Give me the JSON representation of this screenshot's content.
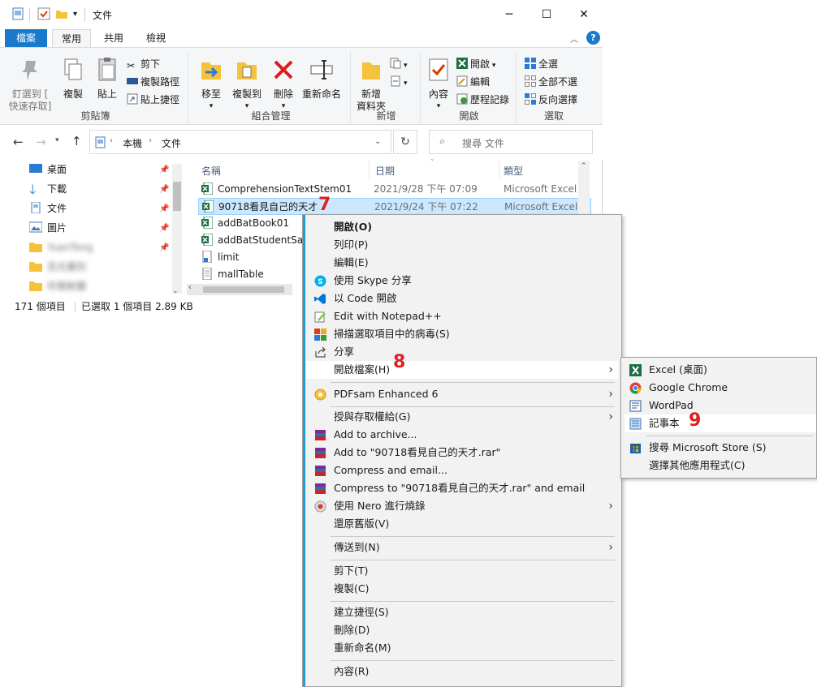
{
  "window": {
    "title": "文件",
    "controls": {
      "minimize": "─",
      "maximize": "☐",
      "close": "✕"
    }
  },
  "ribbon_tabs": [
    "檔案",
    "常用",
    "共用",
    "檢視"
  ],
  "ribbon": {
    "clipboard": {
      "pin_label_1": "釘選到 [",
      "pin_label_2": "快速存取]",
      "copy": "複製",
      "paste": "貼上",
      "cut": "剪下",
      "copy_path": "複製路徑",
      "paste_shortcut": "貼上捷徑",
      "group": "剪貼簿"
    },
    "organize": {
      "move_1": "移至",
      "copy_to_1": "複製到",
      "delete": "刪除",
      "rename": "重新命名",
      "group": "組合管理"
    },
    "new": {
      "new_folder_1": "新增",
      "new_folder_2": "資料夾",
      "group": "新增"
    },
    "open": {
      "properties": "內容",
      "open": "開啟",
      "edit": "編輯",
      "history": "歷程記錄",
      "group": "開啟"
    },
    "select": {
      "all": "全選",
      "none": "全部不選",
      "invert": "反向選擇",
      "group": "選取"
    }
  },
  "nav": {
    "breadcrumb": [
      "本機",
      "文件"
    ],
    "search_placeholder": "搜尋 文件"
  },
  "sidebar": [
    {
      "label": "桌面"
    },
    {
      "label": "下載"
    },
    {
      "label": "文件"
    },
    {
      "label": "圖片"
    },
    {
      "label": "YuanTong"
    },
    {
      "label": "芸光畫別"
    },
    {
      "label": "所需軟體"
    }
  ],
  "columns": {
    "name": "名稱",
    "date": "日期",
    "type": "類型"
  },
  "files": [
    {
      "name": "ComprehensionTextStem01",
      "date": "2021/9/28 下午 07:09",
      "type": "Microsoft Excel ..."
    },
    {
      "name": "90718看見自己的天才",
      "date": "2021/9/24 下午 07:22",
      "type": "Microsoft Excel ..."
    },
    {
      "name": "addBatBook01",
      "date": "",
      "type": ""
    },
    {
      "name": "addBatStudentSam",
      "date": "",
      "type": ""
    },
    {
      "name": "limit",
      "date": "",
      "type": ""
    },
    {
      "name": "mallTable",
      "date": "",
      "type": ""
    }
  ],
  "status": {
    "count": "171 個項目",
    "selected": "已選取 1 個項目  2.89 KB"
  },
  "context_menu": [
    "開啟(O)",
    "列印(P)",
    "編輯(E)",
    "使用 Skype 分享",
    "以 Code 開啟",
    "Edit with Notepad++",
    "掃描選取項目中的病毒(S)",
    "分享",
    "開啟檔案(H)",
    "PDFsam Enhanced 6",
    "授與存取權給(G)",
    "Add to archive...",
    "Add to \"90718看見自己的天才.rar\"",
    "Compress and email...",
    "Compress to \"90718看見自己的天才.rar\" and email",
    "使用 Nero 進行燒錄",
    "還原舊版(V)",
    "傳送到(N)",
    "剪下(T)",
    "複製(C)",
    "建立捷徑(S)",
    "刪除(D)",
    "重新命名(M)",
    "內容(R)"
  ],
  "open_with_menu": [
    "Excel (桌面)",
    "Google Chrome",
    "WordPad",
    "記事本",
    "搜尋 Microsoft Store (S)",
    "選擇其他應用程式(C)"
  ],
  "annotations": {
    "step7": "7",
    "step8": "8",
    "step9": "9"
  },
  "colors": {
    "accent": "#1979ca",
    "selection": "#cce8ff",
    "annotation": "#e01e1e"
  }
}
